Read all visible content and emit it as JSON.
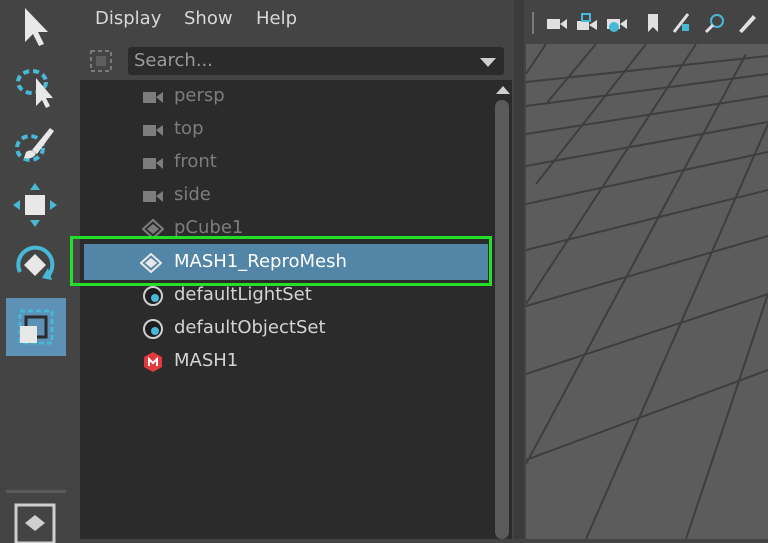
{
  "outliner": {
    "menu": {
      "display": "Display",
      "show": "Show",
      "help": "Help"
    },
    "search": {
      "placeholder": "Search..."
    },
    "items": [
      {
        "label": "persp",
        "icon": "camera-icon",
        "state": "dim"
      },
      {
        "label": "top",
        "icon": "camera-icon",
        "state": "dim"
      },
      {
        "label": "front",
        "icon": "camera-icon",
        "state": "dim"
      },
      {
        "label": "side",
        "icon": "camera-icon",
        "state": "dim"
      },
      {
        "label": "pCube1",
        "icon": "mesh-icon",
        "state": "dim"
      },
      {
        "label": "MASH1_ReproMesh",
        "icon": "mesh-icon",
        "state": "selected"
      },
      {
        "label": "defaultLightSet",
        "icon": "set-icon",
        "state": "normal"
      },
      {
        "label": "defaultObjectSet",
        "icon": "set-icon",
        "state": "normal"
      },
      {
        "label": "MASH1",
        "icon": "mash-icon",
        "state": "normal"
      }
    ]
  },
  "toolbox": {
    "tools": [
      "select-arrow-icon",
      "lasso-select-icon",
      "paint-select-icon",
      "move-tool-icon",
      "rotate-tool-icon",
      "scale-tool-icon"
    ],
    "active_tool": "scale-tool-icon"
  },
  "colors": {
    "selection": "#5285a6",
    "highlight_outline": "#22e028",
    "mash_icon": "#e0393e",
    "accent_blue": "#48b8d8"
  }
}
